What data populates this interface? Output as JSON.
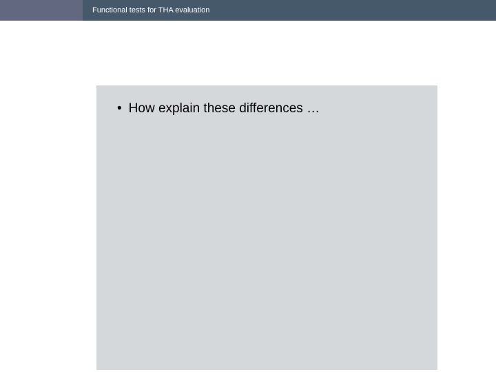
{
  "header": {
    "title": "Functional tests for THA evaluation"
  },
  "content": {
    "bullets": [
      {
        "text": "How explain these differences …"
      }
    ]
  }
}
